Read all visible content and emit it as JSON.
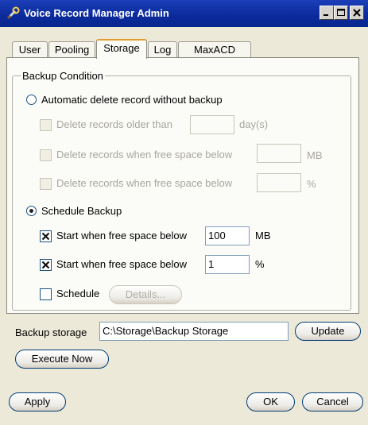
{
  "window": {
    "title": "Voice Record Manager Admin"
  },
  "tabs": [
    {
      "label": "User"
    },
    {
      "label": "Pooling"
    },
    {
      "label": "Storage"
    },
    {
      "label": "Log"
    },
    {
      "label": "MaxACD"
    }
  ],
  "active_tab": "Storage",
  "backup_condition": {
    "title": "Backup Condition",
    "auto_delete": {
      "label": "Automatic delete record without backup",
      "selected": false,
      "options": [
        {
          "label": "Delete records older than",
          "value": "",
          "unit": "day(s)",
          "checked": false,
          "enabled": false
        },
        {
          "label": "Delete records when free space below",
          "value": "",
          "unit": "MB",
          "checked": false,
          "enabled": false
        },
        {
          "label": "Delete records when free space below",
          "value": "",
          "unit": "%",
          "checked": false,
          "enabled": false
        }
      ]
    },
    "schedule_backup": {
      "label": "Schedule Backup",
      "selected": true,
      "options": [
        {
          "label": "Start when free space below",
          "value": "100",
          "unit": "MB",
          "checked": true
        },
        {
          "label": "Start when free space below",
          "value": "1",
          "unit": "%",
          "checked": true
        }
      ],
      "schedule": {
        "label": "Schedule",
        "checked": false,
        "details_button": "Details..."
      }
    }
  },
  "backup_storage": {
    "label": "Backup storage",
    "path": "C:\\Storage\\Backup Storage",
    "update_button": "Update"
  },
  "execute_button": "Execute Now",
  "footer": {
    "apply": "Apply",
    "ok": "OK",
    "cancel": "Cancel"
  },
  "colors": {
    "titlebar": "#0b2a9a",
    "active_tab_accent": "#e69c2a",
    "dialog_bg": "#ece9d8"
  }
}
